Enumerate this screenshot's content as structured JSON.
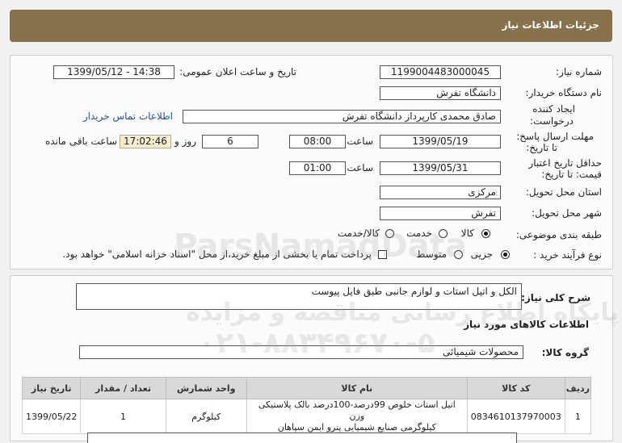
{
  "header": {
    "title": "جزئیات اطلاعات نیاز"
  },
  "form": {
    "need_number_label": "شماره نیاز:",
    "need_number": "1199004483000045",
    "announce_label": "تاریخ و ساعت اعلان عمومی:",
    "announce_value": "1399/05/12 - 14:38",
    "buyer_label": "نام دستگاه خریدار:",
    "buyer_value": "دانشگاه تفرش",
    "creator_label_line1": "ایجاد کننده",
    "creator_label_line2": "درخواست:",
    "creator_value": "صادق محمدی کارپرداز دانشگاه تفرش",
    "contact_link": "اطلاعات تماس خریدار",
    "reply_label_line1": "مهلت ارسال پاسخ:",
    "reply_label_line2": "تا تاریخ:",
    "reply_date": "1399/05/19",
    "time_label": "ساعت",
    "reply_time": "08:00",
    "days_value": "6",
    "days_label": "روز و",
    "remaining_time": "17:02:46",
    "remaining_label": "ساعت باقی مانده",
    "validity_label_line1": "حداقل تاریخ اعتبار",
    "validity_label_line2": "قیمت: تا تاریخ:",
    "validity_date": "1399/05/31",
    "validity_time_label": "ساعت",
    "validity_time": "01:00",
    "province_label": "استان محل تحویل:",
    "province_value": "مرکزی",
    "city_label": "شهر محل تحویل:",
    "city_value": "تفرش",
    "category_label": "طبقه بندی موضوعی:",
    "category_options": [
      "کالا",
      "خدمت",
      "کالا/خدمت"
    ],
    "category_selected": "کالا",
    "process_label": "نوع فرآیند خرید :",
    "process_options": [
      "جزیی",
      "متوسط"
    ],
    "process_selected": "جزیی",
    "payment_note": "پرداخت تمام یا بخشی از مبلغ خرید،از محل \"اسناد خزانه اسلامی\" خواهد بود."
  },
  "description": {
    "label": "شرح کلی نیاز:",
    "value": "الکل و اتیل استات و لوازم جانبی طبق فایل پیوست"
  },
  "goods_section_title": "اطلاعات کالاهای مورد نیاز",
  "goods_group": {
    "label": "گروه کالا:",
    "value": "محصولات شیمیائی"
  },
  "table": {
    "headers": [
      "ردیف",
      "کد کالا",
      "نام کالا",
      "واحد شمارش",
      "تعداد / مقدار",
      "تاریخ نیاز"
    ],
    "rows": [
      {
        "row": "1",
        "code": "0834610137970003",
        "name_line1": "اتیل استات خلوص 99درصد-100درصد بالک پلاستیکی وزن",
        "name_line2": "کیلوگرمی صنایع شیمیایی پترو ایمن سپاهان",
        "unit": "کیلوگرم",
        "qty": "1",
        "date": "1399/05/22"
      }
    ]
  },
  "watermark": {
    "line1": "ParsNamadData",
    "line2": "پایگاه اطلاع رسانی مناقصه و مزایده",
    "line3": "۰۲۱-۸۸۳۴۹۶۷۰-۵"
  },
  "colors": {
    "header_bg": "#87724b",
    "link": "#1d55a8",
    "countdown_bg": "#f4efcf"
  }
}
